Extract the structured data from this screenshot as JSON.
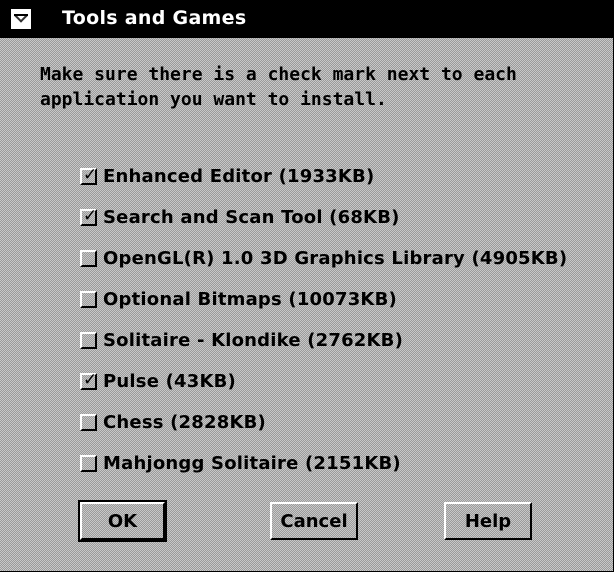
{
  "window": {
    "title": "Tools and Games"
  },
  "instructions": {
    "line1": "Make sure there is a check mark next to each",
    "line2": "application you want to install."
  },
  "items": [
    {
      "label": "Enhanced Editor  (1933KB)",
      "checked": true
    },
    {
      "label": "Search and Scan Tool  (68KB)",
      "checked": true
    },
    {
      "label": "OpenGL(R) 1.0 3D Graphics Library (4905KB)",
      "checked": false
    },
    {
      "label": "Optional Bitmaps (10073KB)",
      "checked": false
    },
    {
      "label": "Solitaire - Klondike  (2762KB)",
      "checked": false
    },
    {
      "label": "Pulse  (43KB)",
      "checked": true
    },
    {
      "label": "Chess  (2828KB)",
      "checked": false
    },
    {
      "label": "Mahjongg Solitaire  (2151KB)",
      "checked": false
    }
  ],
  "buttons": {
    "ok": "OK",
    "cancel": "Cancel",
    "help": "Help"
  },
  "icons": {
    "system_menu": "system-menu-icon",
    "check": "check-mark-icon"
  },
  "colors": {
    "titlebar": "#000000",
    "title_text": "#ffffff",
    "background": "#c8c8c8"
  }
}
